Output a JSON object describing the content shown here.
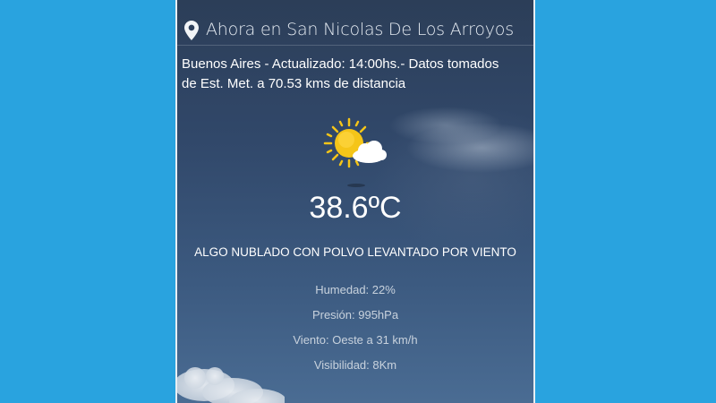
{
  "header": {
    "location_title": "Ahora en San Nicolas De Los Arroyos",
    "icon": "location-pin-icon"
  },
  "station": {
    "info": "Buenos Aires - Actualizado: 14:00hs.- Datos tomados de Est. Met. a 70.53 kms de distancia"
  },
  "weather": {
    "icon": "partly-cloudy-sun-icon",
    "temperature": "38.6ºC",
    "condition": "ALGO NUBLADO CON POLVO LEVANTADO POR VIENTO"
  },
  "details": {
    "humidity": "Humedad: 22%",
    "pressure": "Presión: 995hPa",
    "wind": "Viento: Oeste a 31 km/h",
    "visibility": "Visibilidad: 8Km"
  },
  "colors": {
    "background": "#29a3df",
    "sun": "#f5c518"
  }
}
